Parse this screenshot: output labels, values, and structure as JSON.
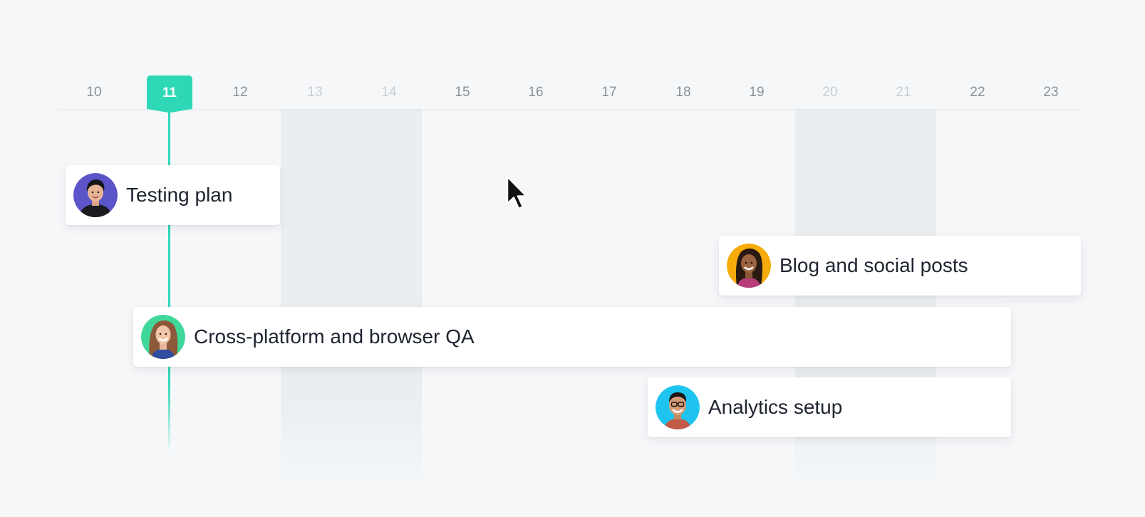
{
  "timeline": {
    "days": [
      {
        "label": "10",
        "weekend": false
      },
      {
        "label": "11",
        "weekend": false,
        "today": true
      },
      {
        "label": "12",
        "weekend": false
      },
      {
        "label": "13",
        "weekend": true
      },
      {
        "label": "14",
        "weekend": true
      },
      {
        "label": "15",
        "weekend": false
      },
      {
        "label": "16",
        "weekend": false
      },
      {
        "label": "17",
        "weekend": false
      },
      {
        "label": "18",
        "weekend": false
      },
      {
        "label": "19",
        "weekend": false
      },
      {
        "label": "20",
        "weekend": true
      },
      {
        "label": "21",
        "weekend": true
      },
      {
        "label": "22",
        "weekend": false
      },
      {
        "label": "23",
        "weekend": false
      }
    ],
    "today_label": "11"
  },
  "tasks": [
    {
      "label": "Testing plan",
      "avatar_color": "#5b55c9"
    },
    {
      "label": "Blog and social posts",
      "avatar_color": "#f6ab0a"
    },
    {
      "label": "Cross-platform and browser QA",
      "avatar_color": "#3fd89a"
    },
    {
      "label": "Analytics setup",
      "avatar_color": "#1ec4ef"
    }
  ],
  "colors": {
    "accent": "#2ed8b6",
    "background": "#f5f7f9",
    "weekend": "#ebeef0",
    "text": "#1e2430"
  },
  "icons": {
    "cursor": "mouse-pointer-icon"
  }
}
